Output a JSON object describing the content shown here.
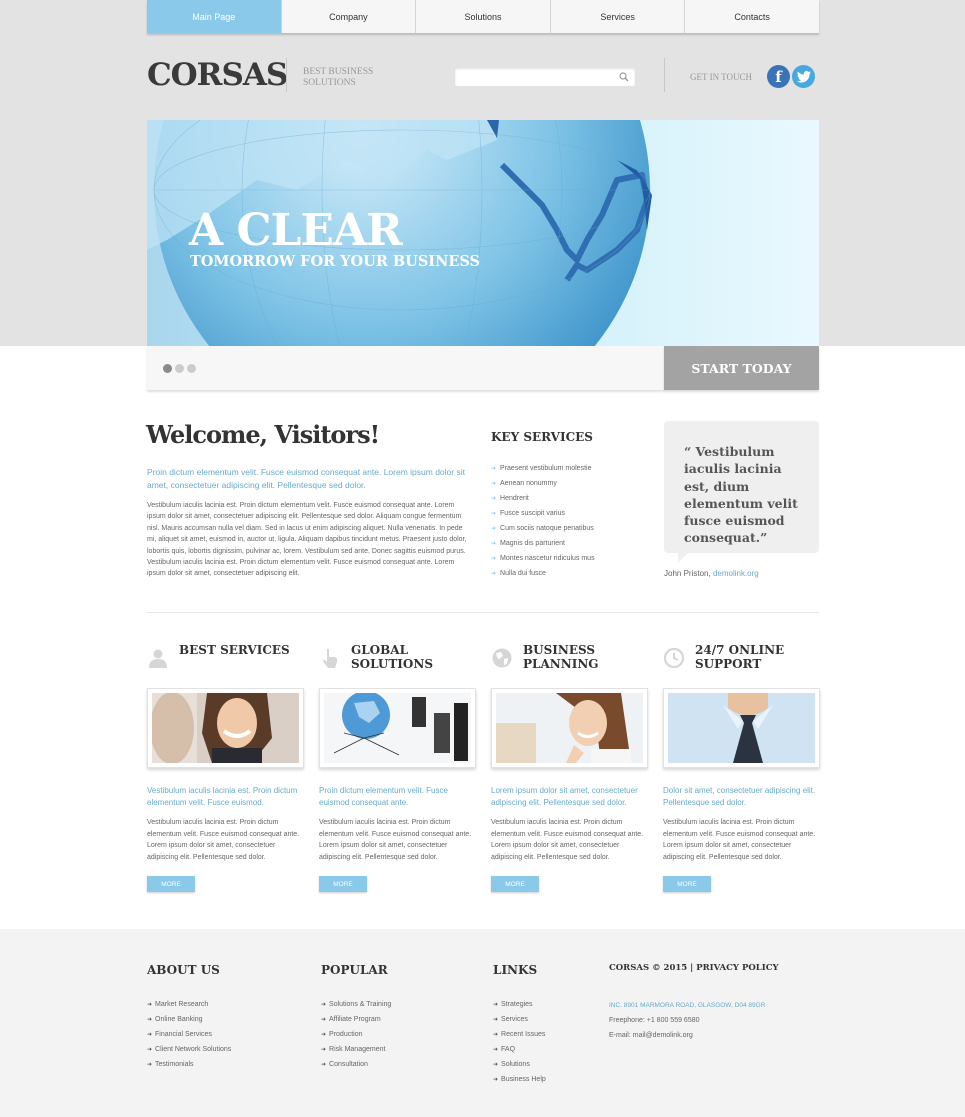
{
  "nav": {
    "items": [
      "Main Page",
      "Company",
      "Solutions",
      "Services",
      "Contacts"
    ],
    "active_index": 0
  },
  "header": {
    "logo": "CORSAS",
    "tagline": "BEST BUSINESS SOLUTIONS",
    "search_value": "",
    "get_in_touch": "GET IN TOUCH",
    "social": [
      {
        "name": "facebook",
        "glyph": "f"
      },
      {
        "name": "twitter",
        "glyph": "twitter-bird"
      }
    ]
  },
  "hero": {
    "title": "A CLEAR",
    "subtitle": "TOMORROW FOR YOUR BUSINESS",
    "slide_count": 3,
    "active_slide": 1,
    "cta": "START TODAY"
  },
  "welcome": {
    "title": "Welcome, Visitors!",
    "lead": "Proin dictum elementum velit. Fusce euismod consequat ante. Lorem ipsum dolor sit amet, consectetuer adipiscing elit. Pellentesque sed dolor.",
    "body": "Vestibulum iaculis lacinia est. Proin dictum elementum velit. Fusce euismod consequat ante. Lorem ipsum dolor sit amet, consectetuer adipiscing elit. Pellentesque sed dolor. Aliquam congue fermentum nisl. Mauris accumsan nulla vel diam. Sed in lacus ut enim adipiscing aliquet. Nulla venenatis. In pede mi, aliquet sit amet, euismod in, auctor ut, ligula. Aliquam dapibus tincidunt metus. Praesent justo dolor, lobortis quis, lobortis dignissim, pulvinar ac, lorem. Vestibulum sed ante. Donec sagittis euismod purus. Vestibulum iaculis lacinia est. Proin dictum elementum velit. Fusce euismod consequat ante. Lorem ipsum dolor sit amet, consectetuer adipiscing elit."
  },
  "key_services": {
    "title": "KEY SERVICES",
    "items": [
      "Praesent vestibulum molestie",
      "Aenean nonummy",
      "Hendrerit",
      "Fusce suscipit varius",
      "Cum sociis natoque penatibus",
      "Magnis dis parturient",
      "Montes nascetur ridiculus mus",
      "Nulla dui fusce"
    ]
  },
  "testimonial": {
    "quote": "“ Vestibulum iaculis lacinia est, dium elementum velit fusce euismod consequat.”",
    "author": "John Priston,",
    "link": "demolink.org"
  },
  "features": [
    {
      "title": "BEST SERVICES",
      "icon": "user-icon",
      "lead": "Vestibulum iaculis lacinia est. Proin dictum elementum velit.  Fusce euismod.",
      "body": "Vestibulum iaculis lacinia est. Proin dictum elementum velit.  Fusce euismod consequat ante. Lorem ipsum dolor sit amet, consectetuer adipiscing elit. Pellentesque sed dolor.",
      "more": "MORE",
      "image": "smiling-woman-photo"
    },
    {
      "title": "GLOBAL SOLUTIONS",
      "icon": "hand-pointer-icon",
      "lead": "Proin dictum elementum velit. Fusce euismod consequat ante.",
      "body": "Vestibulum iaculis lacinia est. Proin dictum elementum velit.  Fusce euismod consequat ante. Lorem ipsum dolor sit amet, consectetuer adipiscing elit. Pellentesque sed dolor.",
      "more": "MORE",
      "image": "globe-network-photo"
    },
    {
      "title": "BUSINESS PLANNING",
      "icon": "globe-icon",
      "lead": "Lorem ipsum dolor sit amet, consectetuer adipiscing elit. Pellentesque sed dolor.",
      "body": "Vestibulum iaculis lacinia est. Proin dictum elementum velit.  Fusce euismod consequat ante. Lorem ipsum dolor sit amet, consectetuer adipiscing elit. Pellentesque sed dolor.",
      "more": "MORE",
      "image": "thinking-woman-photo"
    },
    {
      "title": "24/7 ONLINE SUPPORT",
      "icon": "clock-icon",
      "lead": "Dolor sit amet, consectetuer adipiscing elit. Pellentesque sed dolor.",
      "body": "Vestibulum iaculis lacinia est. Proin dictum elementum velit.  Fusce euismod consequat ante. Lorem ipsum dolor sit amet, consectetuer adipiscing elit. Pellentesque sed dolor.",
      "more": "MORE",
      "image": "man-tie-photo"
    }
  ],
  "footer": {
    "about": {
      "title": "ABOUT US",
      "items": [
        "Market Research",
        "Online Banking",
        "Financial Services",
        "Client Network Solutions",
        "Testimonials"
      ]
    },
    "popular": {
      "title": "POPULAR",
      "items": [
        "Solutions & Training",
        "Affiliate Program",
        "Production",
        "Risk Management",
        "Consultation"
      ]
    },
    "links": {
      "title": "LINKS",
      "items": [
        "Strategies",
        "Services",
        "Recent Issues",
        "FAQ",
        "Solutions",
        "Business Help"
      ]
    },
    "copyright": "CORSAS © 2015  |  PRIVACY POLICY",
    "address": "INC. 8901 MARMORA ROAD, GLASGOW, D04 89GR",
    "freephone": "Freephone: +1 800 559 6580",
    "email_label": "E-mail: ",
    "email": "mail@demolink.org"
  },
  "colors": {
    "accent": "#8bc9ea",
    "text_accent": "#68aac9",
    "cta": "#a3a3a3",
    "top_band": "#e3e3e3"
  }
}
